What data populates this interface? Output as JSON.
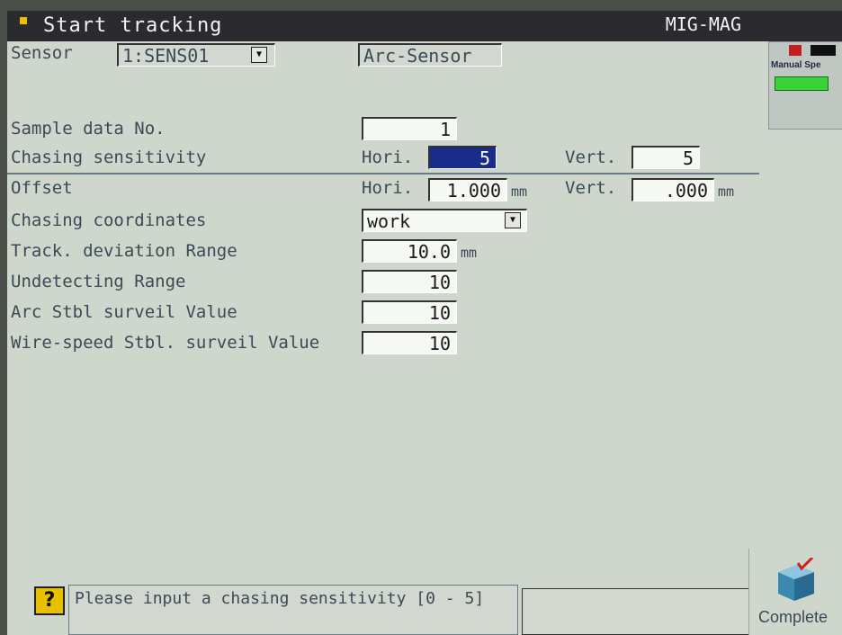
{
  "titlebar": {
    "title": "Start tracking",
    "mode": "MIG-MAG"
  },
  "side_panel": {
    "label": "Manual Spe"
  },
  "sensor": {
    "label": "Sensor",
    "value": "1:SENS01",
    "type": "Arc-Sensor"
  },
  "sample": {
    "label": "Sample data No.",
    "value": "1"
  },
  "chasing_sensitivity": {
    "label": "Chasing sensitivity",
    "hori_label": "Hori.",
    "hori_value": "5",
    "vert_label": "Vert.",
    "vert_value": "5"
  },
  "offset": {
    "label": "Offset",
    "hori_label": "Hori.",
    "hori_value": "1.000",
    "hori_unit": "mm",
    "vert_label": "Vert.",
    "vert_value": ".000",
    "vert_unit": "mm"
  },
  "chasing_coordinates": {
    "label": "Chasing coordinates",
    "value": "work"
  },
  "track_deviation": {
    "label": "Track. deviation Range",
    "value": "10.0",
    "unit": "mm"
  },
  "undetecting": {
    "label": "Undetecting Range",
    "value": "10"
  },
  "arc_stbl": {
    "label": "Arc Stbl surveil Value",
    "value": "10"
  },
  "wire_speed": {
    "label": "Wire-speed Stbl. surveil Value",
    "value": "10"
  },
  "message": {
    "text": "Please input a chasing sensitivity  [0 - 5]"
  },
  "footer": {
    "complete_label": "Complete"
  },
  "colors": {
    "titlebar": "#2b2b2f",
    "background": "#cfd6cc",
    "selected": "#1a2c8a",
    "help": "#e8c000"
  }
}
